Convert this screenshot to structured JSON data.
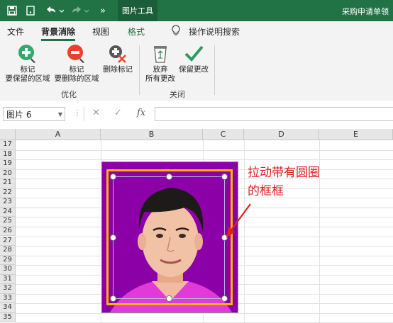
{
  "titlebar": {
    "context_tab": "图片工具",
    "doc_title": "采购申请单领"
  },
  "ribbon_tabs": [
    "文件",
    "背景消除",
    "视图",
    "格式"
  ],
  "tell_me": "操作说明搜索",
  "groups": {
    "optimize": {
      "label": "优化",
      "mark_keep": "标记\n要保留的区域",
      "mark_remove": "标记\n要删除的区域",
      "delete_mark": "删除标记"
    },
    "close": {
      "label": "关闭",
      "discard": "放弃\n所有更改",
      "keep_changes": "保留更改"
    }
  },
  "formula_bar": {
    "name_box": "图片 6",
    "cancel_symbol": "✕",
    "enter_symbol": "✓",
    "fx": "fx",
    "value": ""
  },
  "columns": [
    "A",
    "B",
    "C",
    "D",
    "E"
  ],
  "rows": [
    "17",
    "18",
    "19",
    "20",
    "21",
    "22",
    "23",
    "24",
    "25",
    "26",
    "27",
    "28",
    "29",
    "30",
    "31",
    "32",
    "33",
    "34",
    "35"
  ],
  "annotation": "拉动带有圆圈\n的框框",
  "colors": {
    "excel_green": "#217346",
    "picture_background": "#8c00a8",
    "keep_frame": "#ffb300",
    "annotation": "#e02020"
  }
}
